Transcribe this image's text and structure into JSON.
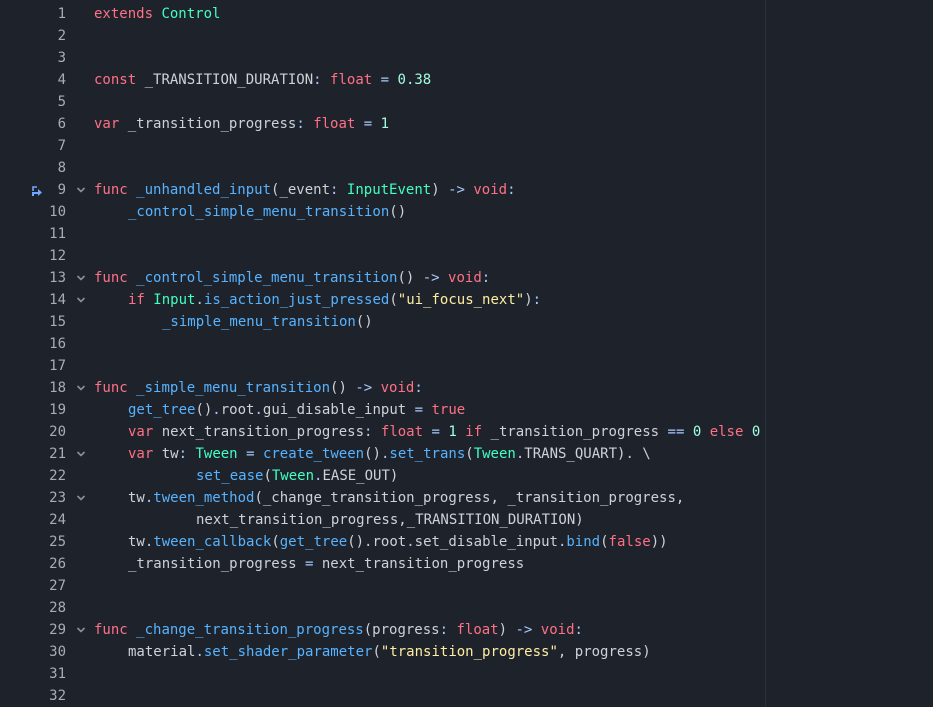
{
  "editor": {
    "language": "GDScript",
    "colors": {
      "background": "#1e232b",
      "line_number": "#a8adb5",
      "keyword": "#ff7085",
      "type": "#42ffc2",
      "function": "#57b3ff",
      "number": "#a1ffe0",
      "string": "#ffeda1",
      "text": "#cdd2d8",
      "operator": "#abc9ff"
    },
    "lines": [
      {
        "n": "1",
        "fold": false,
        "icon": "",
        "indent": 0,
        "tokens": [
          {
            "t": "extends",
            "c": "kw"
          },
          {
            "t": " ",
            "c": "tx"
          },
          {
            "t": "Control",
            "c": "ty"
          }
        ]
      },
      {
        "n": "2",
        "fold": false,
        "icon": "",
        "indent": 0,
        "tokens": []
      },
      {
        "n": "3",
        "fold": false,
        "icon": "",
        "indent": 0,
        "tokens": []
      },
      {
        "n": "4",
        "fold": false,
        "icon": "",
        "indent": 0,
        "tokens": [
          {
            "t": "const",
            "c": "kw"
          },
          {
            "t": " _TRANSITION_DURATION",
            "c": "tx"
          },
          {
            "t": ":",
            "c": "op"
          },
          {
            "t": " ",
            "c": "tx"
          },
          {
            "t": "float",
            "c": "kw"
          },
          {
            "t": " ",
            "c": "tx"
          },
          {
            "t": "=",
            "c": "op"
          },
          {
            "t": " ",
            "c": "tx"
          },
          {
            "t": "0.38",
            "c": "nm"
          }
        ]
      },
      {
        "n": "5",
        "fold": false,
        "icon": "",
        "indent": 0,
        "tokens": []
      },
      {
        "n": "6",
        "fold": false,
        "icon": "",
        "indent": 0,
        "tokens": [
          {
            "t": "var",
            "c": "kw"
          },
          {
            "t": " _transition_progress",
            "c": "tx"
          },
          {
            "t": ":",
            "c": "op"
          },
          {
            "t": " ",
            "c": "tx"
          },
          {
            "t": "float",
            "c": "kw"
          },
          {
            "t": " ",
            "c": "tx"
          },
          {
            "t": "=",
            "c": "op"
          },
          {
            "t": " ",
            "c": "tx"
          },
          {
            "t": "1",
            "c": "nm"
          }
        ]
      },
      {
        "n": "7",
        "fold": false,
        "icon": "",
        "indent": 0,
        "tokens": []
      },
      {
        "n": "8",
        "fold": false,
        "icon": "",
        "indent": 0,
        "tokens": []
      },
      {
        "n": "9",
        "fold": true,
        "icon": "override-icon",
        "indent": 0,
        "tokens": [
          {
            "t": "func",
            "c": "kw"
          },
          {
            "t": " ",
            "c": "tx"
          },
          {
            "t": "_unhandled_input",
            "c": "fn"
          },
          {
            "t": "(_event",
            "c": "tx"
          },
          {
            "t": ":",
            "c": "op"
          },
          {
            "t": " ",
            "c": "tx"
          },
          {
            "t": "InputEvent",
            "c": "ty"
          },
          {
            "t": ") ",
            "c": "tx"
          },
          {
            "t": "->",
            "c": "op"
          },
          {
            "t": " ",
            "c": "tx"
          },
          {
            "t": "void",
            "c": "kw"
          },
          {
            "t": ":",
            "c": "op"
          }
        ]
      },
      {
        "n": "10",
        "fold": false,
        "icon": "",
        "indent": 1,
        "tokens": [
          {
            "t": "_control_simple_menu_transition",
            "c": "fn"
          },
          {
            "t": "()",
            "c": "tx"
          }
        ]
      },
      {
        "n": "11",
        "fold": false,
        "icon": "",
        "indent": 0,
        "tokens": []
      },
      {
        "n": "12",
        "fold": false,
        "icon": "",
        "indent": 0,
        "tokens": []
      },
      {
        "n": "13",
        "fold": true,
        "icon": "",
        "indent": 0,
        "tokens": [
          {
            "t": "func",
            "c": "kw"
          },
          {
            "t": " ",
            "c": "tx"
          },
          {
            "t": "_control_simple_menu_transition",
            "c": "fn"
          },
          {
            "t": "() ",
            "c": "tx"
          },
          {
            "t": "->",
            "c": "op"
          },
          {
            "t": " ",
            "c": "tx"
          },
          {
            "t": "void",
            "c": "kw"
          },
          {
            "t": ":",
            "c": "op"
          }
        ]
      },
      {
        "n": "14",
        "fold": true,
        "icon": "",
        "indent": 1,
        "tokens": [
          {
            "t": "if",
            "c": "kw"
          },
          {
            "t": " ",
            "c": "tx"
          },
          {
            "t": "Input",
            "c": "ty"
          },
          {
            "t": ".",
            "c": "op"
          },
          {
            "t": "is_action_just_pressed",
            "c": "fn"
          },
          {
            "t": "(",
            "c": "tx"
          },
          {
            "t": "\"ui_focus_next\"",
            "c": "st"
          },
          {
            "t": ")",
            "c": "tx"
          },
          {
            "t": ":",
            "c": "op"
          }
        ]
      },
      {
        "n": "15",
        "fold": false,
        "icon": "",
        "indent": 2,
        "tokens": [
          {
            "t": "_simple_menu_transition",
            "c": "fn"
          },
          {
            "t": "()",
            "c": "tx"
          }
        ]
      },
      {
        "n": "16",
        "fold": false,
        "icon": "",
        "indent": 0,
        "tokens": []
      },
      {
        "n": "17",
        "fold": false,
        "icon": "",
        "indent": 0,
        "tokens": []
      },
      {
        "n": "18",
        "fold": true,
        "icon": "",
        "indent": 0,
        "tokens": [
          {
            "t": "func",
            "c": "kw"
          },
          {
            "t": " ",
            "c": "tx"
          },
          {
            "t": "_simple_menu_transition",
            "c": "fn"
          },
          {
            "t": "() ",
            "c": "tx"
          },
          {
            "t": "->",
            "c": "op"
          },
          {
            "t": " ",
            "c": "tx"
          },
          {
            "t": "void",
            "c": "kw"
          },
          {
            "t": ":",
            "c": "op"
          }
        ]
      },
      {
        "n": "19",
        "fold": false,
        "icon": "",
        "indent": 1,
        "tokens": [
          {
            "t": "get_tree",
            "c": "fn"
          },
          {
            "t": "()",
            "c": "tx"
          },
          {
            "t": ".",
            "c": "op"
          },
          {
            "t": "root",
            "c": "tx"
          },
          {
            "t": ".",
            "c": "op"
          },
          {
            "t": "gui_disable_input ",
            "c": "tx"
          },
          {
            "t": "=",
            "c": "op"
          },
          {
            "t": " ",
            "c": "tx"
          },
          {
            "t": "true",
            "c": "kw"
          }
        ]
      },
      {
        "n": "20",
        "fold": false,
        "icon": "",
        "indent": 1,
        "tokens": [
          {
            "t": "var",
            "c": "kw"
          },
          {
            "t": " next_transition_progress",
            "c": "tx"
          },
          {
            "t": ":",
            "c": "op"
          },
          {
            "t": " ",
            "c": "tx"
          },
          {
            "t": "float",
            "c": "kw"
          },
          {
            "t": " ",
            "c": "tx"
          },
          {
            "t": "=",
            "c": "op"
          },
          {
            "t": " ",
            "c": "tx"
          },
          {
            "t": "1",
            "c": "nm"
          },
          {
            "t": " ",
            "c": "tx"
          },
          {
            "t": "if",
            "c": "kw"
          },
          {
            "t": " _transition_progress ",
            "c": "tx"
          },
          {
            "t": "==",
            "c": "op"
          },
          {
            "t": " ",
            "c": "tx"
          },
          {
            "t": "0",
            "c": "nm"
          },
          {
            "t": " ",
            "c": "tx"
          },
          {
            "t": "else",
            "c": "kw"
          },
          {
            "t": " ",
            "c": "tx"
          },
          {
            "t": "0",
            "c": "nm"
          }
        ]
      },
      {
        "n": "21",
        "fold": true,
        "icon": "",
        "indent": 1,
        "tokens": [
          {
            "t": "var",
            "c": "kw"
          },
          {
            "t": " tw",
            "c": "tx"
          },
          {
            "t": ":",
            "c": "op"
          },
          {
            "t": " ",
            "c": "tx"
          },
          {
            "t": "Tween",
            "c": "ty"
          },
          {
            "t": " ",
            "c": "tx"
          },
          {
            "t": "=",
            "c": "op"
          },
          {
            "t": " ",
            "c": "tx"
          },
          {
            "t": "create_tween",
            "c": "fn"
          },
          {
            "t": "()",
            "c": "tx"
          },
          {
            "t": ".",
            "c": "op"
          },
          {
            "t": "set_trans",
            "c": "fn"
          },
          {
            "t": "(",
            "c": "tx"
          },
          {
            "t": "Tween",
            "c": "ty"
          },
          {
            "t": ".",
            "c": "op"
          },
          {
            "t": "TRANS_QUART",
            "c": "tx"
          },
          {
            "t": ")",
            "c": "tx"
          },
          {
            "t": ".",
            "c": "op"
          },
          {
            "t": " \\",
            "c": "tx"
          }
        ]
      },
      {
        "n": "22",
        "fold": false,
        "icon": "",
        "indent": 3,
        "tokens": [
          {
            "t": "set_ease",
            "c": "fn"
          },
          {
            "t": "(",
            "c": "tx"
          },
          {
            "t": "Tween",
            "c": "ty"
          },
          {
            "t": ".",
            "c": "op"
          },
          {
            "t": "EASE_OUT",
            "c": "tx"
          },
          {
            "t": ")",
            "c": "tx"
          }
        ]
      },
      {
        "n": "23",
        "fold": true,
        "icon": "",
        "indent": 1,
        "tokens": [
          {
            "t": "tw",
            "c": "tx"
          },
          {
            "t": ".",
            "c": "op"
          },
          {
            "t": "tween_method",
            "c": "fn"
          },
          {
            "t": "(_change_transition_progress, _transition_progress,",
            "c": "tx"
          }
        ]
      },
      {
        "n": "24",
        "fold": false,
        "icon": "",
        "indent": 3,
        "tokens": [
          {
            "t": "next_transition_progress,_TRANSITION_DURATION)",
            "c": "tx"
          }
        ]
      },
      {
        "n": "25",
        "fold": false,
        "icon": "",
        "indent": 1,
        "tokens": [
          {
            "t": "tw",
            "c": "tx"
          },
          {
            "t": ".",
            "c": "op"
          },
          {
            "t": "tween_callback",
            "c": "fn"
          },
          {
            "t": "(",
            "c": "tx"
          },
          {
            "t": "get_tree",
            "c": "fn"
          },
          {
            "t": "()",
            "c": "tx"
          },
          {
            "t": ".",
            "c": "op"
          },
          {
            "t": "root",
            "c": "tx"
          },
          {
            "t": ".",
            "c": "op"
          },
          {
            "t": "set_disable_input",
            "c": "tx"
          },
          {
            "t": ".",
            "c": "op"
          },
          {
            "t": "bind",
            "c": "fn"
          },
          {
            "t": "(",
            "c": "tx"
          },
          {
            "t": "false",
            "c": "kw"
          },
          {
            "t": "))",
            "c": "tx"
          }
        ]
      },
      {
        "n": "26",
        "fold": false,
        "icon": "",
        "indent": 1,
        "tokens": [
          {
            "t": "_transition_progress ",
            "c": "tx"
          },
          {
            "t": "=",
            "c": "op"
          },
          {
            "t": " next_transition_progress",
            "c": "tx"
          }
        ]
      },
      {
        "n": "27",
        "fold": false,
        "icon": "",
        "indent": 0,
        "tokens": []
      },
      {
        "n": "28",
        "fold": false,
        "icon": "",
        "indent": 0,
        "tokens": []
      },
      {
        "n": "29",
        "fold": true,
        "icon": "",
        "indent": 0,
        "tokens": [
          {
            "t": "func",
            "c": "kw"
          },
          {
            "t": " ",
            "c": "tx"
          },
          {
            "t": "_change_transition_progress",
            "c": "fn"
          },
          {
            "t": "(progress",
            "c": "tx"
          },
          {
            "t": ":",
            "c": "op"
          },
          {
            "t": " ",
            "c": "tx"
          },
          {
            "t": "float",
            "c": "kw"
          },
          {
            "t": ") ",
            "c": "tx"
          },
          {
            "t": "->",
            "c": "op"
          },
          {
            "t": " ",
            "c": "tx"
          },
          {
            "t": "void",
            "c": "kw"
          },
          {
            "t": ":",
            "c": "op"
          }
        ]
      },
      {
        "n": "30",
        "fold": false,
        "icon": "",
        "indent": 1,
        "tokens": [
          {
            "t": "material",
            "c": "tx"
          },
          {
            "t": ".",
            "c": "op"
          },
          {
            "t": "set_shader_parameter",
            "c": "fn"
          },
          {
            "t": "(",
            "c": "tx"
          },
          {
            "t": "\"transition_progress\"",
            "c": "st"
          },
          {
            "t": ", progress)",
            "c": "tx"
          }
        ]
      },
      {
        "n": "31",
        "fold": false,
        "icon": "",
        "indent": 0,
        "tokens": []
      },
      {
        "n": "32",
        "fold": false,
        "icon": "",
        "indent": 0,
        "tokens": []
      }
    ]
  }
}
